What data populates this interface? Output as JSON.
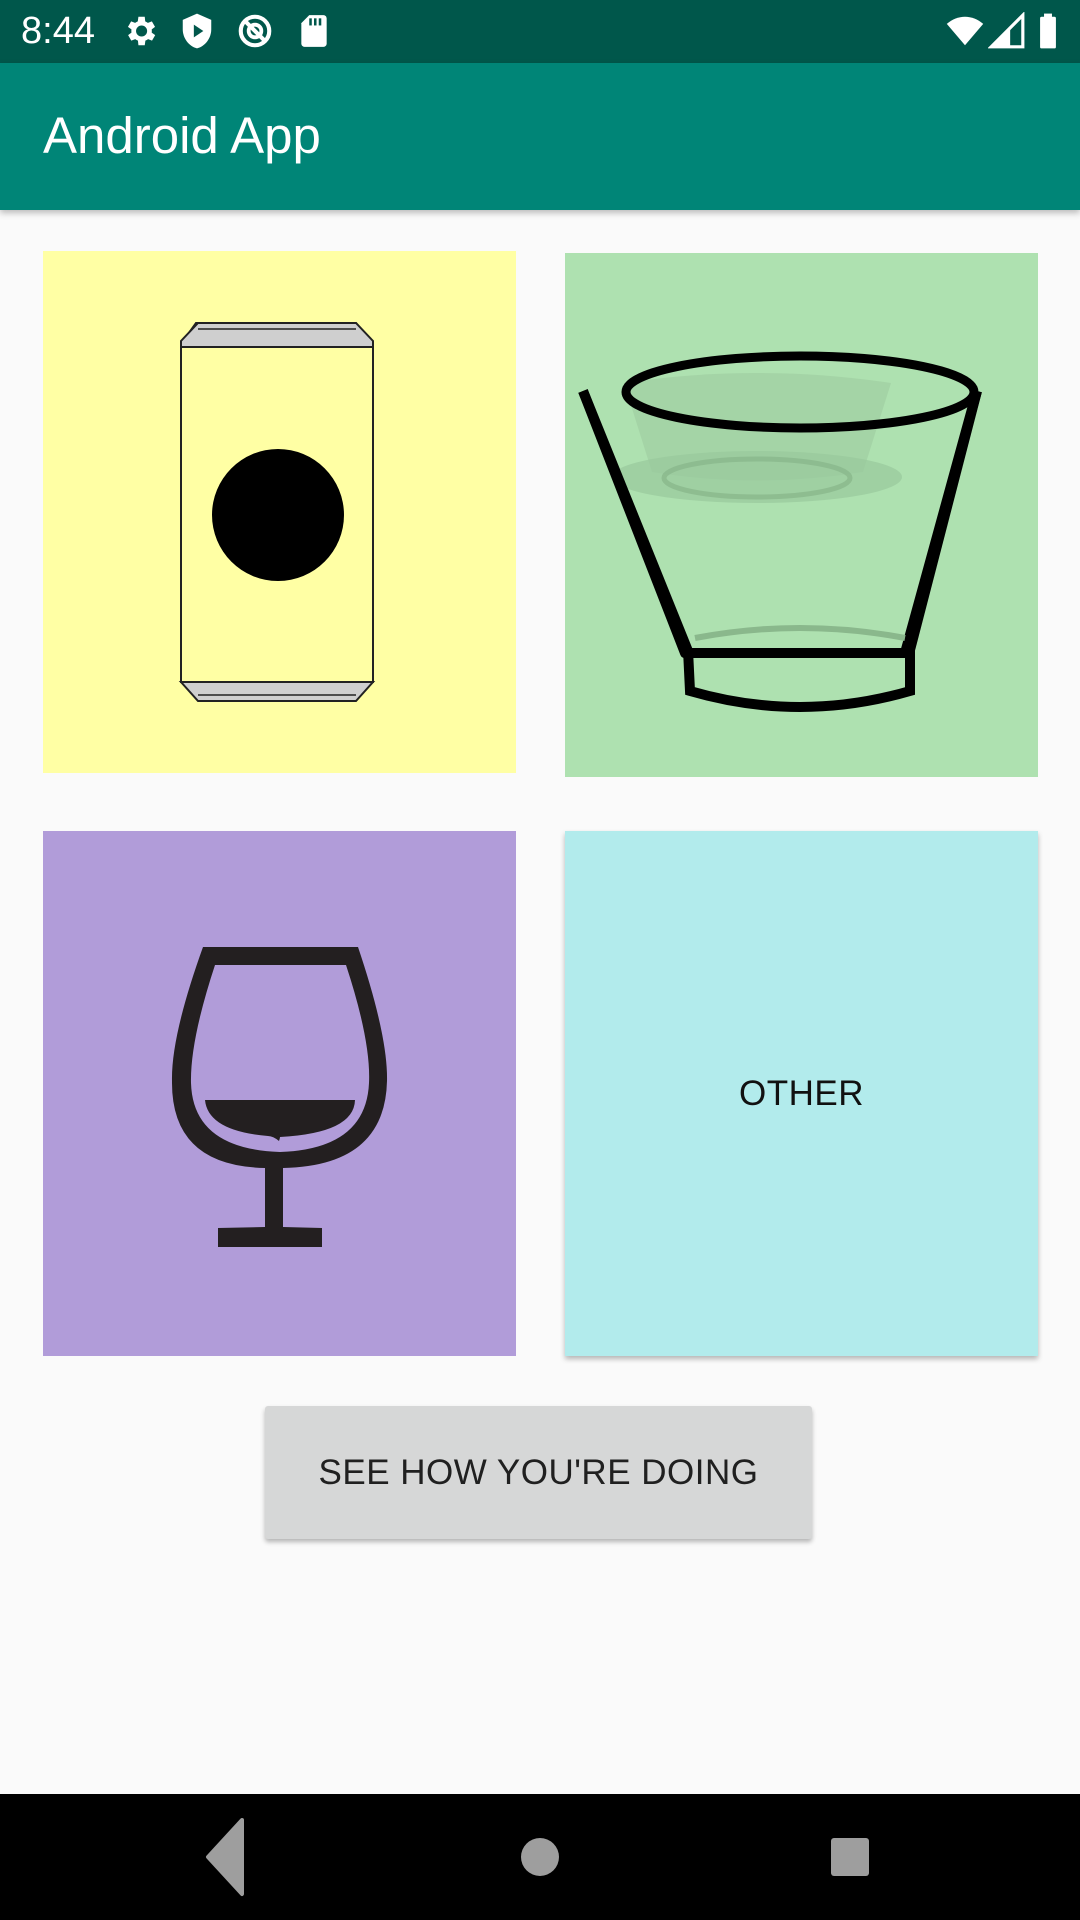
{
  "status_bar": {
    "time": "8:44",
    "left_icons": [
      "settings-icon",
      "play-protect-icon",
      "no-drm-icon",
      "sd-card-icon"
    ],
    "right_icons": [
      "wifi-icon",
      "cell-signal-icon",
      "battery-icon"
    ],
    "background": "#00574b"
  },
  "app_bar": {
    "title": "Android App",
    "background": "#008577"
  },
  "drink_options": [
    {
      "id": "can",
      "icon": "beer-can-icon",
      "background": "#ffffa4"
    },
    {
      "id": "glass",
      "icon": "water-glass-icon",
      "background": "#aee1b0"
    },
    {
      "id": "wine",
      "icon": "wine-glass-icon",
      "background": "#b19cd9"
    },
    {
      "id": "other",
      "label": "OTHER",
      "background": "#b2ebec"
    }
  ],
  "progress_button": {
    "label": "SEE HOW YOU'RE DOING"
  },
  "nav_bar": {
    "buttons": [
      "back-icon",
      "home-icon",
      "recents-icon"
    ]
  }
}
